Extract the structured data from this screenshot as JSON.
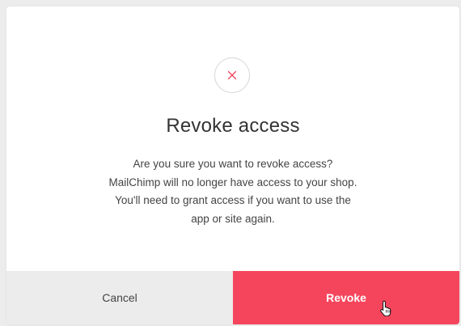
{
  "dialog": {
    "title": "Revoke access",
    "message_lines": [
      "Are you sure you want to revoke access?",
      "MailChimp will no longer have access to your shop.",
      "You'll need to grant access if you want to use the",
      "app or site again."
    ],
    "icon": "close-icon",
    "icon_color": "#f5455c"
  },
  "actions": {
    "cancel_label": "Cancel",
    "revoke_label": "Revoke"
  },
  "colors": {
    "revoke_button_bg": "#f5455c",
    "cancel_button_bg": "#ececec",
    "text_primary": "#333333"
  },
  "cursor": "hand-pointer-icon"
}
